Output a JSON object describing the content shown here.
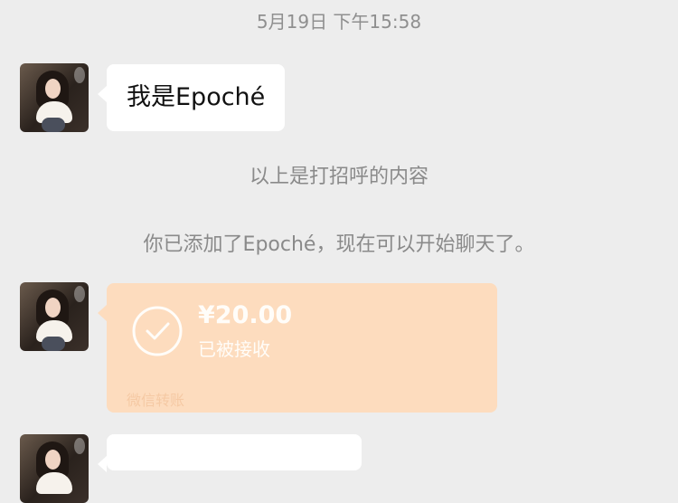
{
  "chat": {
    "timestamp": "5月19日 下午15:58",
    "messages": [
      {
        "type": "text",
        "text": "我是Epoché"
      }
    ],
    "system_notes": [
      "以上是打招呼的内容",
      "你已添加了Epoché，现在可以开始聊天了。"
    ],
    "transfer": {
      "amount": "¥20.00",
      "status": "已被接收",
      "footer": "微信转账",
      "icon": "check-circle-icon"
    }
  },
  "colors": {
    "background": "#ededed",
    "bubble": "#ffffff",
    "transfer_card": "#fddcbe",
    "transfer_text": "#fffdf9",
    "system_text": "#8a8a8a"
  }
}
